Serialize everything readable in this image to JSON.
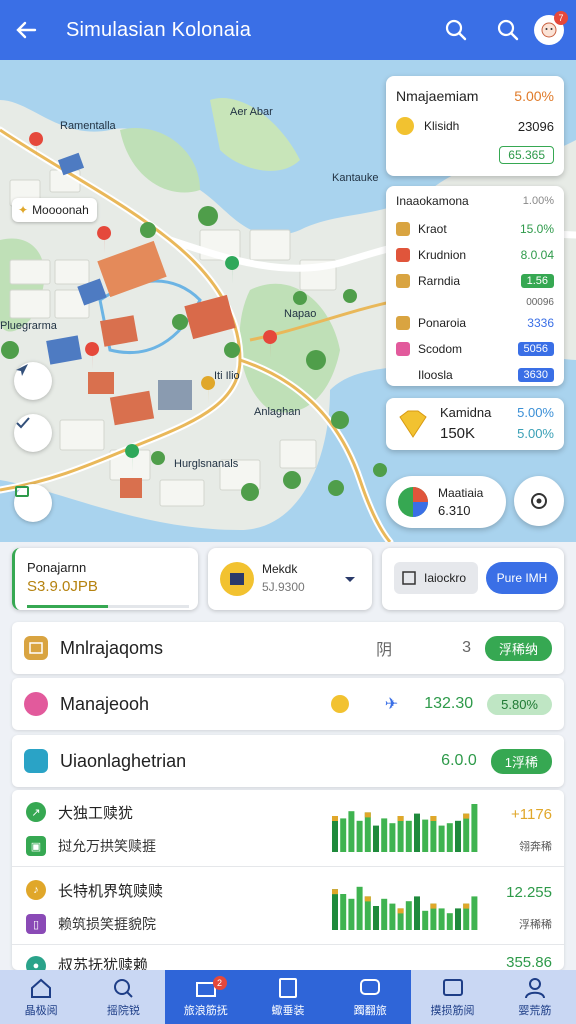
{
  "header": {
    "title": "Simulasian Kolonaia",
    "notification_count": "7"
  },
  "map": {
    "labels": [
      "Ramentalla",
      "Aer Abar",
      "Kantauke",
      "Pluegrarma",
      "Napao",
      "Anlaghan",
      "Hurglsnanals"
    ],
    "place_pill": "Moooonah",
    "hotel_tag": "Iti Ilio"
  },
  "cards": {
    "card1": {
      "title": "Nmajaemiam",
      "title_value": "5.00%",
      "label": "Klisidh",
      "value": "23096",
      "button": "65.365"
    },
    "card2": {
      "title": "Inaaokamona",
      "title_value": "1.00%",
      "rows": [
        {
          "label": "Kraot",
          "value": "15.0%",
          "color": "#d9a441"
        },
        {
          "label": "Krudnion",
          "value": "8.0.04",
          "color": "#e0553b"
        },
        {
          "label": "Rarndia",
          "value": "1.56",
          "color": "#d9a441"
        },
        {
          "label": "",
          "value": "00096",
          "color": ""
        },
        {
          "label": "Ponaroia",
          "value": "3336",
          "color": "#d9a441"
        },
        {
          "label": "Scodom",
          "value": "5056",
          "color": "#e25a9c"
        },
        {
          "label": "Iloosla",
          "value": "3630",
          "color": ""
        }
      ]
    },
    "card3": {
      "title": "Kamidna",
      "value_top": "5.00%",
      "amount": "150K",
      "value_bottom": "5.00%"
    },
    "card4": {
      "title": "Maatiaia",
      "value": "6.310"
    }
  },
  "midstrip": {
    "left": {
      "title": "Ponajarnn",
      "value": "S3.9.0JPB"
    },
    "center": {
      "title": "Mekdk",
      "value": "5J.9300"
    },
    "right": {
      "label": "Iaiockro",
      "button": "Pure IMH"
    }
  },
  "list": [
    {
      "name": "Mnlrajaqoms",
      "mid": "阴",
      "num": "3",
      "pill": "浮稀纳"
    },
    {
      "name": "Manajeooh",
      "mid": "",
      "num": "132.30",
      "pill": "5.80%"
    },
    {
      "name": "Uiaonlaghetrian",
      "mid": "",
      "num": "6.0.0",
      "pill": "1浮稀"
    }
  ],
  "charts": [
    {
      "line1": "大独工赎犹",
      "line2": "挝允万拱笑赎捱",
      "num": "+1176",
      "sub": "翎奔稀"
    },
    {
      "line1": "长特机界筑赎赎",
      "line2": "赖筑损笑捱貌院",
      "num": "12.255",
      "sub": "浮稀稀"
    },
    {
      "line1": "叔苏抚犹赎赖",
      "line2": "",
      "num": "355.86",
      "sub": ""
    }
  ],
  "chart_data": [
    {
      "type": "bar",
      "series": [
        {
          "values": [
            30,
            28,
            34,
            26,
            33,
            22,
            28,
            24,
            30,
            26,
            32,
            27,
            30,
            22,
            24,
            26,
            32,
            40
          ]
        }
      ]
    },
    {
      "type": "bar",
      "series": [
        {
          "values": [
            34,
            30,
            26,
            36,
            28,
            20,
            26,
            22,
            18,
            24,
            28,
            16,
            22,
            18,
            14,
            18,
            22,
            28
          ]
        }
      ]
    }
  ],
  "nav": [
    {
      "label": "晶极阅",
      "icon": "home-icon"
    },
    {
      "label": "摇院锐",
      "icon": "search-icon"
    },
    {
      "label": "旅浪筋抚",
      "icon": "shop-icon",
      "badge": "2"
    },
    {
      "label": "蠍垂装",
      "icon": "note-icon"
    },
    {
      "label": "躅翻旅",
      "icon": "chat-icon"
    },
    {
      "label": "摸损筋阅",
      "icon": "tv-icon"
    },
    {
      "label": "婴荒筋",
      "icon": "user-icon"
    }
  ],
  "colors": {
    "primary": "#3a6fe6",
    "green": "#36a852",
    "water": "#a9d3ee",
    "park": "#bfe0b7"
  }
}
